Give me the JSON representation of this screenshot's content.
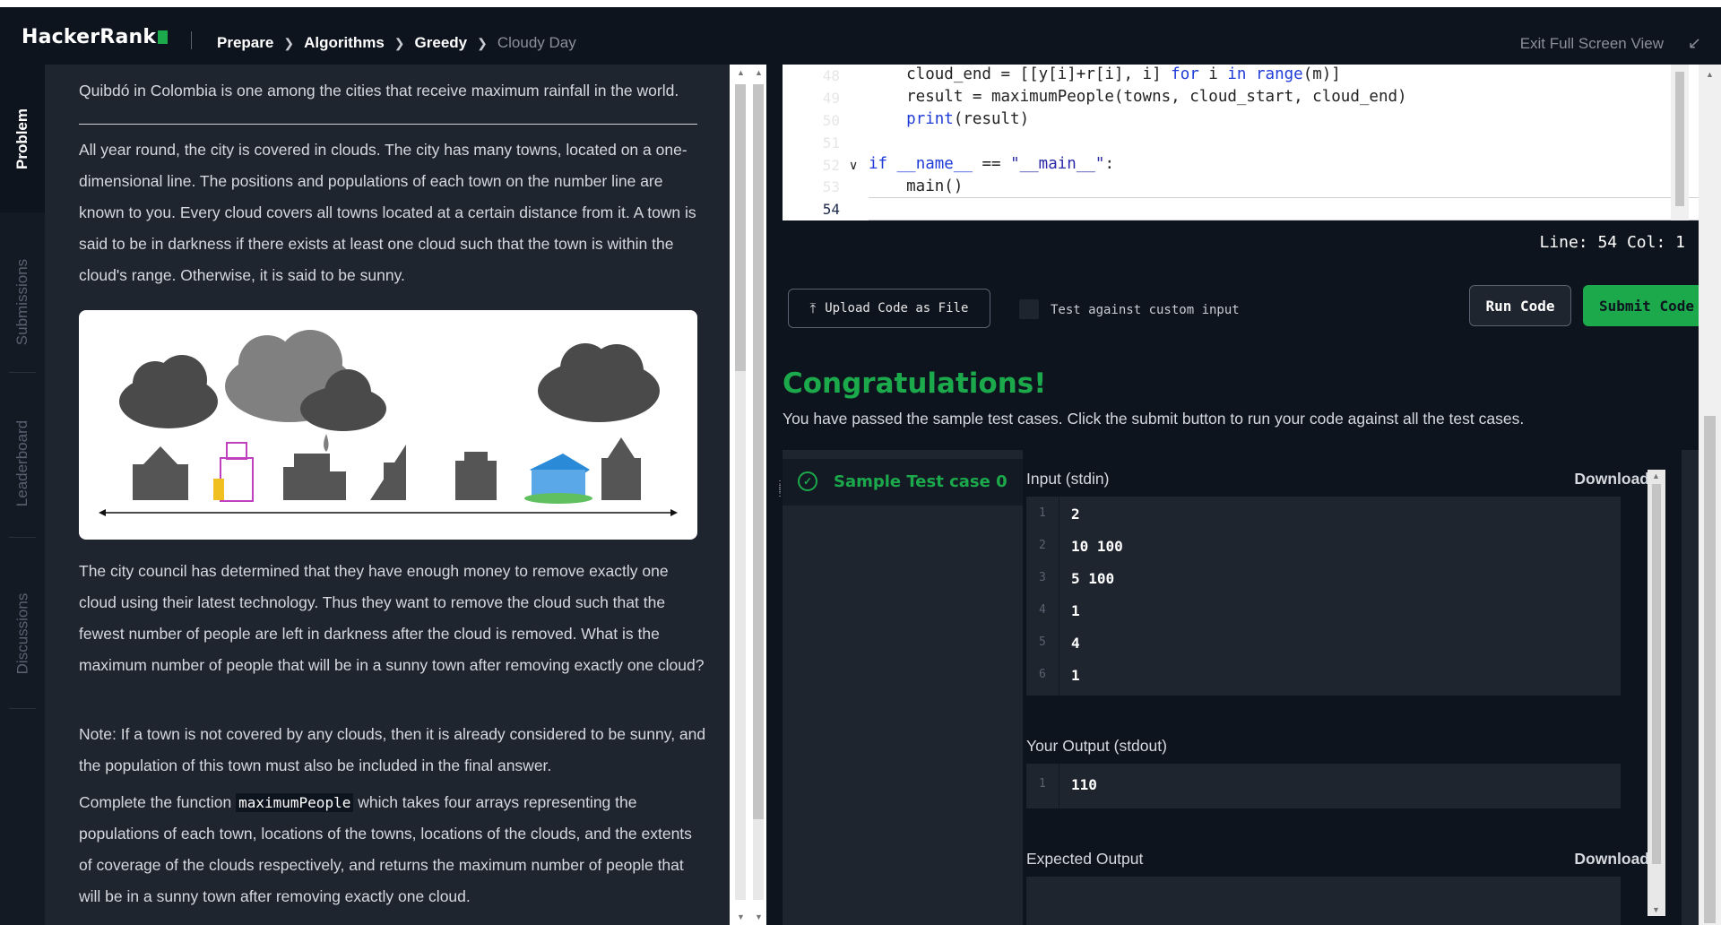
{
  "header": {
    "logo_text": "HackerRank",
    "breadcrumbs": [
      "Prepare",
      "Algorithms",
      "Greedy"
    ],
    "current": "Cloudy Day",
    "exit_fullscreen": "Exit Full Screen View"
  },
  "side_tabs": [
    "Problem",
    "Submissions",
    "Leaderboard",
    "Discussions"
  ],
  "problem": {
    "intro": "Quibdó in Colombia is one among the cities that receive maximum rainfall in the world.",
    "para1": "All year round, the city is covered in clouds. The city has many towns, located on a one-dimensional line. The positions and populations of each town on the number line are known to you. Every cloud covers all towns located at a certain distance from it. A town is said to be in darkness if there exists at least one cloud such that the town is within the cloud's range. Otherwise, it is said to be sunny.",
    "para2": "The city council has determined that they have enough money to remove exactly one cloud using their latest technology. Thus they want to remove the cloud such that the fewest number of people are left in darkness after the cloud is removed. What is the maximum number of people that will be in a sunny town after removing exactly one cloud?",
    "para3": "Note: If a town is not covered by any clouds, then it is already considered to be sunny, and the population of this town must also be included in the final answer.",
    "para4_pre": "Complete the function ",
    "para4_code": "maximumPeople",
    "para4_post": " which takes four arrays representing the populations of each town, locations of the towns, locations of the clouds, and the extents of coverage of the clouds respectively, and returns the maximum number of people that will be in a sunny town after removing exactly one cloud."
  },
  "editor": {
    "line_numbers": [
      "48",
      "49",
      "50",
      "51",
      "52",
      "53",
      "54"
    ],
    "status": "Line: 54 Col: 1"
  },
  "toolbar": {
    "upload_label": "Upload Code as File",
    "custom_input_label": "Test against custom input",
    "run_label": "Run Code",
    "submit_label": "Submit Code"
  },
  "result": {
    "title": "Congratulations!",
    "subtitle": "You have passed the sample test cases. Click the submit button to run your code against all the test cases.",
    "testcase_label": "Sample Test case 0",
    "input_title": "Input (stdin)",
    "download_label": "Download",
    "input_lines": [
      {
        "n": "1",
        "v": "2"
      },
      {
        "n": "2",
        "v": "10 100"
      },
      {
        "n": "3",
        "v": "5 100"
      },
      {
        "n": "4",
        "v": "1"
      },
      {
        "n": "5",
        "v": "4"
      },
      {
        "n": "6",
        "v": "1"
      }
    ],
    "output_title": "Your Output (stdout)",
    "output_lines": [
      {
        "n": "1",
        "v": "110"
      }
    ],
    "expected_title": "Expected Output",
    "expected_download": "Download"
  },
  "colors": {
    "brand_green": "#1ba94c",
    "bg_dark": "#0e141e",
    "panel": "#1f252f"
  }
}
